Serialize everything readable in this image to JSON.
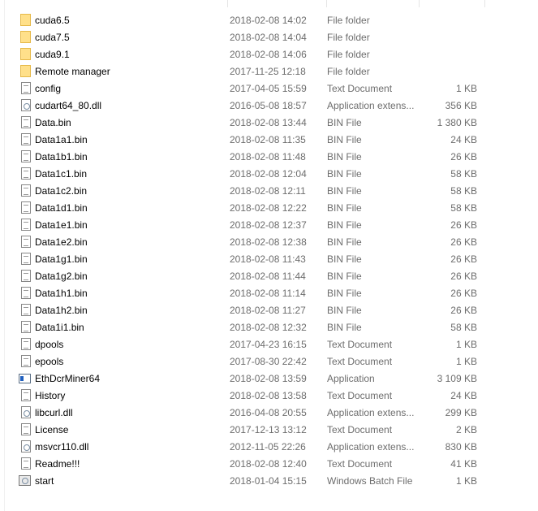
{
  "files": [
    {
      "name": "cuda6.5",
      "date": "2018-02-08 14:02",
      "type": "File folder",
      "size": "",
      "icon": "folder-icon"
    },
    {
      "name": "cuda7.5",
      "date": "2018-02-08 14:04",
      "type": "File folder",
      "size": "",
      "icon": "folder-icon"
    },
    {
      "name": "cuda9.1",
      "date": "2018-02-08 14:06",
      "type": "File folder",
      "size": "",
      "icon": "folder-icon"
    },
    {
      "name": "Remote manager",
      "date": "2017-11-25 12:18",
      "type": "File folder",
      "size": "",
      "icon": "folder-icon"
    },
    {
      "name": "config",
      "date": "2017-04-05 15:59",
      "type": "Text Document",
      "size": "1 KB",
      "icon": "text-document-icon"
    },
    {
      "name": "cudart64_80.dll",
      "date": "2016-05-08 18:57",
      "type": "Application extens...",
      "size": "356 KB",
      "icon": "dll-icon"
    },
    {
      "name": "Data.bin",
      "date": "2018-02-08 13:44",
      "type": "BIN File",
      "size": "1 380 KB",
      "icon": "file-icon"
    },
    {
      "name": "Data1a1.bin",
      "date": "2018-02-08 11:35",
      "type": "BIN File",
      "size": "24 KB",
      "icon": "file-icon"
    },
    {
      "name": "Data1b1.bin",
      "date": "2018-02-08 11:48",
      "type": "BIN File",
      "size": "26 KB",
      "icon": "file-icon"
    },
    {
      "name": "Data1c1.bin",
      "date": "2018-02-08 12:04",
      "type": "BIN File",
      "size": "58 KB",
      "icon": "file-icon"
    },
    {
      "name": "Data1c2.bin",
      "date": "2018-02-08 12:11",
      "type": "BIN File",
      "size": "58 KB",
      "icon": "file-icon"
    },
    {
      "name": "Data1d1.bin",
      "date": "2018-02-08 12:22",
      "type": "BIN File",
      "size": "58 KB",
      "icon": "file-icon"
    },
    {
      "name": "Data1e1.bin",
      "date": "2018-02-08 12:37",
      "type": "BIN File",
      "size": "26 KB",
      "icon": "file-icon"
    },
    {
      "name": "Data1e2.bin",
      "date": "2018-02-08 12:38",
      "type": "BIN File",
      "size": "26 KB",
      "icon": "file-icon"
    },
    {
      "name": "Data1g1.bin",
      "date": "2018-02-08 11:43",
      "type": "BIN File",
      "size": "26 KB",
      "icon": "file-icon"
    },
    {
      "name": "Data1g2.bin",
      "date": "2018-02-08 11:44",
      "type": "BIN File",
      "size": "26 KB",
      "icon": "file-icon"
    },
    {
      "name": "Data1h1.bin",
      "date": "2018-02-08 11:14",
      "type": "BIN File",
      "size": "26 KB",
      "icon": "file-icon"
    },
    {
      "name": "Data1h2.bin",
      "date": "2018-02-08 11:27",
      "type": "BIN File",
      "size": "26 KB",
      "icon": "file-icon"
    },
    {
      "name": "Data1i1.bin",
      "date": "2018-02-08 12:32",
      "type": "BIN File",
      "size": "58 KB",
      "icon": "file-icon"
    },
    {
      "name": "dpools",
      "date": "2017-04-23 16:15",
      "type": "Text Document",
      "size": "1 KB",
      "icon": "text-document-icon"
    },
    {
      "name": "epools",
      "date": "2017-08-30 22:42",
      "type": "Text Document",
      "size": "1 KB",
      "icon": "text-document-icon"
    },
    {
      "name": "EthDcrMiner64",
      "date": "2018-02-08 13:59",
      "type": "Application",
      "size": "3 109 KB",
      "icon": "application-icon"
    },
    {
      "name": "History",
      "date": "2018-02-08 13:58",
      "type": "Text Document",
      "size": "24 KB",
      "icon": "text-document-icon"
    },
    {
      "name": "libcurl.dll",
      "date": "2016-04-08 20:55",
      "type": "Application extens...",
      "size": "299 KB",
      "icon": "dll-icon"
    },
    {
      "name": "License",
      "date": "2017-12-13 13:12",
      "type": "Text Document",
      "size": "2 KB",
      "icon": "text-document-icon"
    },
    {
      "name": "msvcr110.dll",
      "date": "2012-11-05 22:26",
      "type": "Application extens...",
      "size": "830 KB",
      "icon": "dll-icon"
    },
    {
      "name": "Readme!!!",
      "date": "2018-02-08 12:40",
      "type": "Text Document",
      "size": "41 KB",
      "icon": "text-document-icon"
    },
    {
      "name": "start",
      "date": "2018-01-04 15:15",
      "type": "Windows Batch File",
      "size": "1 KB",
      "icon": "batch-file-icon"
    }
  ]
}
